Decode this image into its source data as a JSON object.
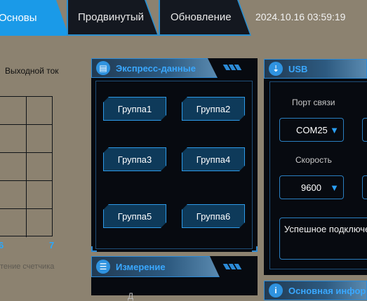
{
  "tabs": [
    {
      "label": "Основы",
      "active": true
    },
    {
      "label": "Продвинутый",
      "active": false
    },
    {
      "label": "Обновление",
      "active": false
    }
  ],
  "datetime": "2024.10.16 03:59:19",
  "left_chart": {
    "title": "Выходной ток",
    "x_ticks": [
      "6",
      "7"
    ],
    "footer": "тение счетчика"
  },
  "express_panel": {
    "title": "Экспресс-данные",
    "icon": "document-icon",
    "groups": [
      "Группа1",
      "Группа2",
      "Группа3",
      "Группа4",
      "Группа5",
      "Группа6"
    ]
  },
  "measure_panel": {
    "title": "Измерение",
    "icon": "menu-icon",
    "partial_text": "Д"
  },
  "usb_panel": {
    "title": "USB",
    "icon": "usb-icon",
    "port_label": "Порт связи",
    "port_value": "COM25",
    "speed_label": "Скорость",
    "speed_value": "9600",
    "status_text": "Успешное подключе"
  },
  "info_panel": {
    "title": "Основная инфор",
    "icon": "info-icon"
  },
  "colors": {
    "accent": "#1a9ae8",
    "panel_bg": "#070a10",
    "background": "#8c8270"
  }
}
